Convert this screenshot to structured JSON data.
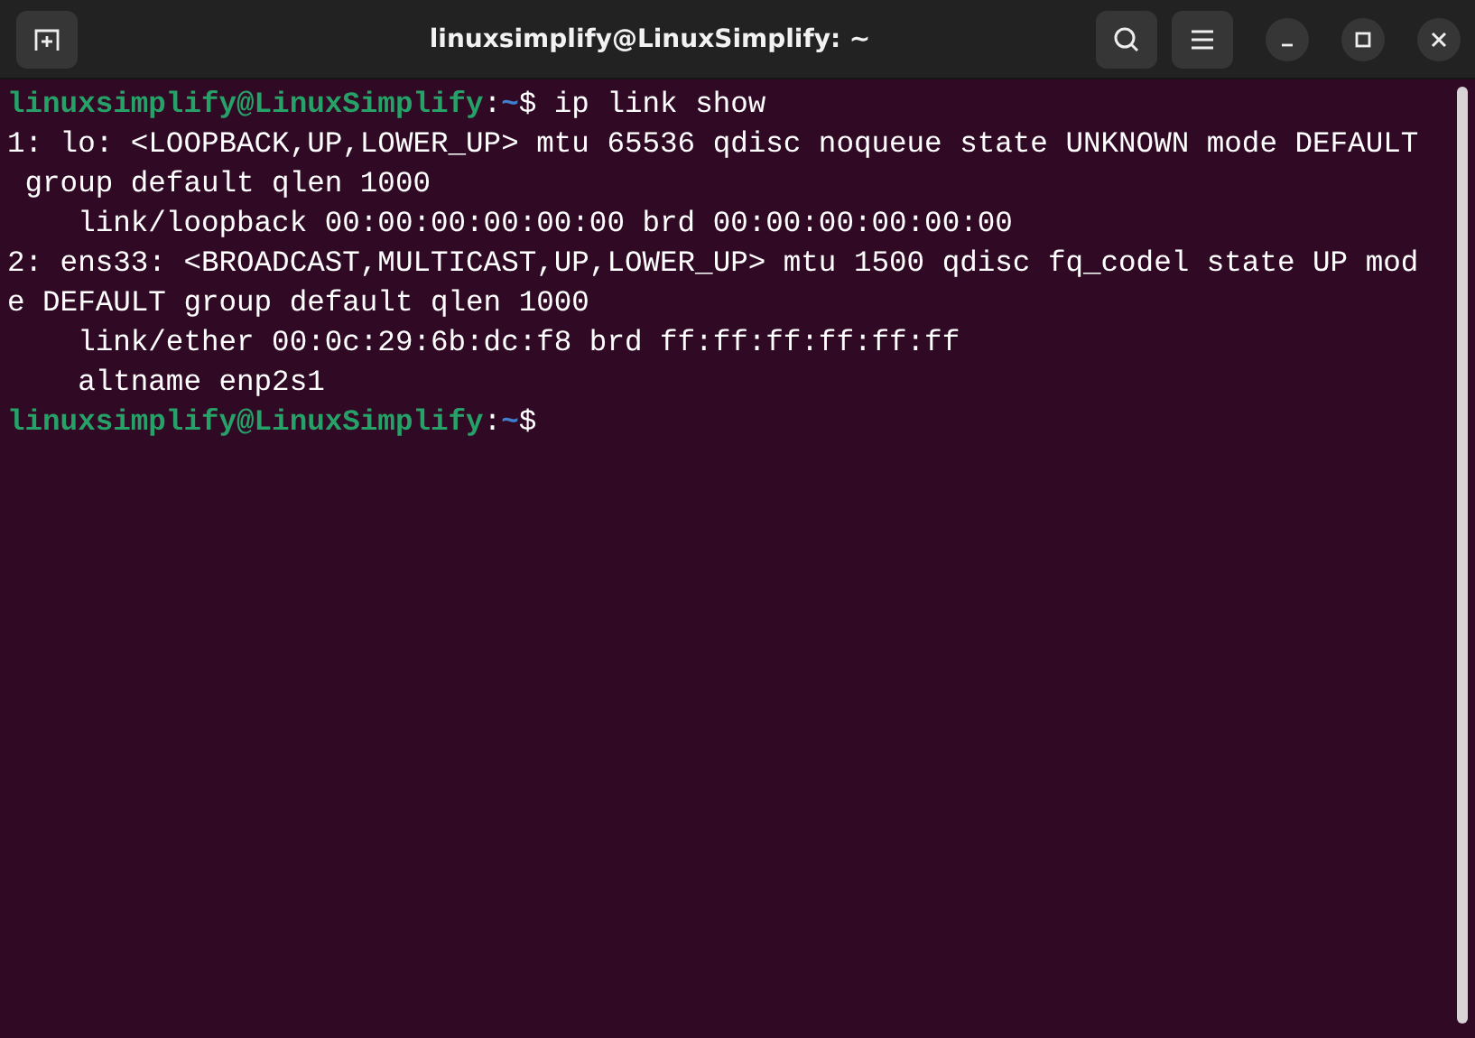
{
  "window": {
    "title": "linuxsimplify@LinuxSimplify: ~"
  },
  "terminal": {
    "lines": [
      {
        "kind": "prompt",
        "user": "linuxsimplify@LinuxSimplify",
        "separator": ":",
        "path": "~",
        "command": "$ ip link show"
      },
      {
        "kind": "output",
        "text": "1: lo: <LOOPBACK,UP,LOWER_UP> mtu 65536 qdisc noqueue state UNKNOWN mode DEFAULT"
      },
      {
        "kind": "output",
        "text": " group default qlen 1000"
      },
      {
        "kind": "output",
        "text": "    link/loopback 00:00:00:00:00:00 brd 00:00:00:00:00:00"
      },
      {
        "kind": "output",
        "text": "2: ens33: <BROADCAST,MULTICAST,UP,LOWER_UP> mtu 1500 qdisc fq_codel state UP mod"
      },
      {
        "kind": "output",
        "text": "e DEFAULT group default qlen 1000"
      },
      {
        "kind": "output",
        "text": "    link/ether 00:0c:29:6b:dc:f8 brd ff:ff:ff:ff:ff:ff"
      },
      {
        "kind": "output",
        "text": "    altname enp2s1"
      },
      {
        "kind": "prompt",
        "user": "linuxsimplify@LinuxSimplify",
        "separator": ":",
        "path": "~",
        "command": "$"
      }
    ]
  }
}
